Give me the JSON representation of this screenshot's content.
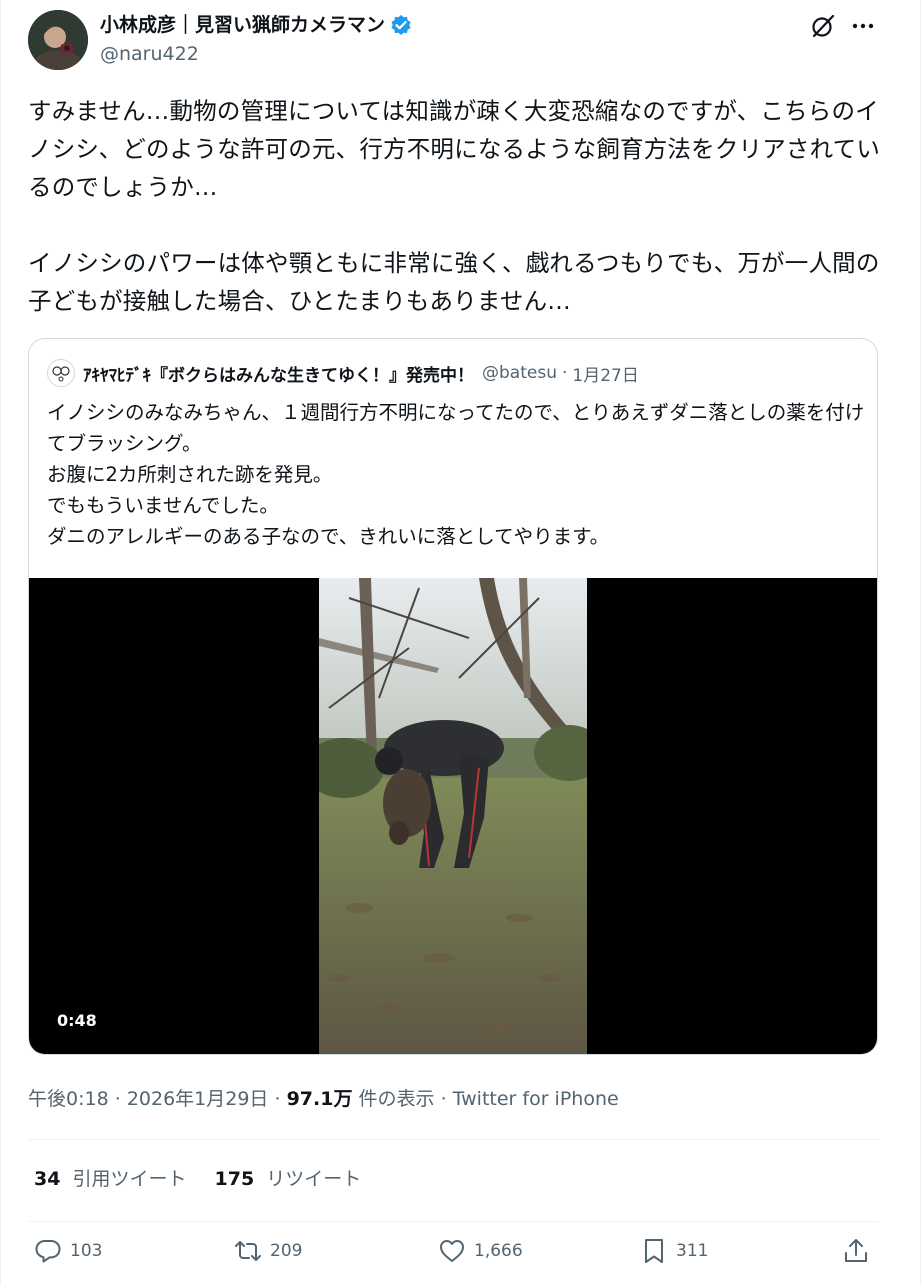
{
  "author": {
    "name": "小林成彦｜見習い猟師カメラマン",
    "handle": "@naru422",
    "verified_color": "#1d9bf0"
  },
  "header_icons": [
    "grok-icon",
    "more-icon"
  ],
  "tweet": {
    "text": "すみません…動物の管理については知識が疎く大変恐縮なのですが、こちらのイノシシ、どのような許可の元、行方不明になるような飼育方法をクリアされているのでしょうか…\n\nイノシシのパワーは体や顎ともに非常に強く、戯れるつもりでも、万が一人間の子どもが接触した場合、ひとたまりもありません…"
  },
  "quote": {
    "name": "ｱｷﾔﾏﾋﾃﾞｷ『ボクらはみんな生きてゆく！』発売中！",
    "handle": "@batesu",
    "separator": "·",
    "date": "1月27日",
    "text": "イノシシのみなみちゃん、１週間行方不明になってたので、とりあえずダニ落としの薬を付けてブラッシング。\nお腹に2カ所刺された跡を発見。\nでももういませんでした。\nダニのアレルギーのある子なので、きれいに落としてやります。",
    "video_duration": "0:48"
  },
  "meta": {
    "time": "午後0:18",
    "date": "2026年1月29日",
    "views": "97.1万",
    "views_label": "件の表示",
    "source": "Twitter for iPhone",
    "sep": "·"
  },
  "stats": {
    "quotes_count": "34",
    "quotes_label": "引用ツイート",
    "retweets_count": "175",
    "retweets_label": "リツイート"
  },
  "actions": {
    "replies": "103",
    "retweets": "209",
    "likes": "1,666",
    "bookmarks": "311"
  }
}
